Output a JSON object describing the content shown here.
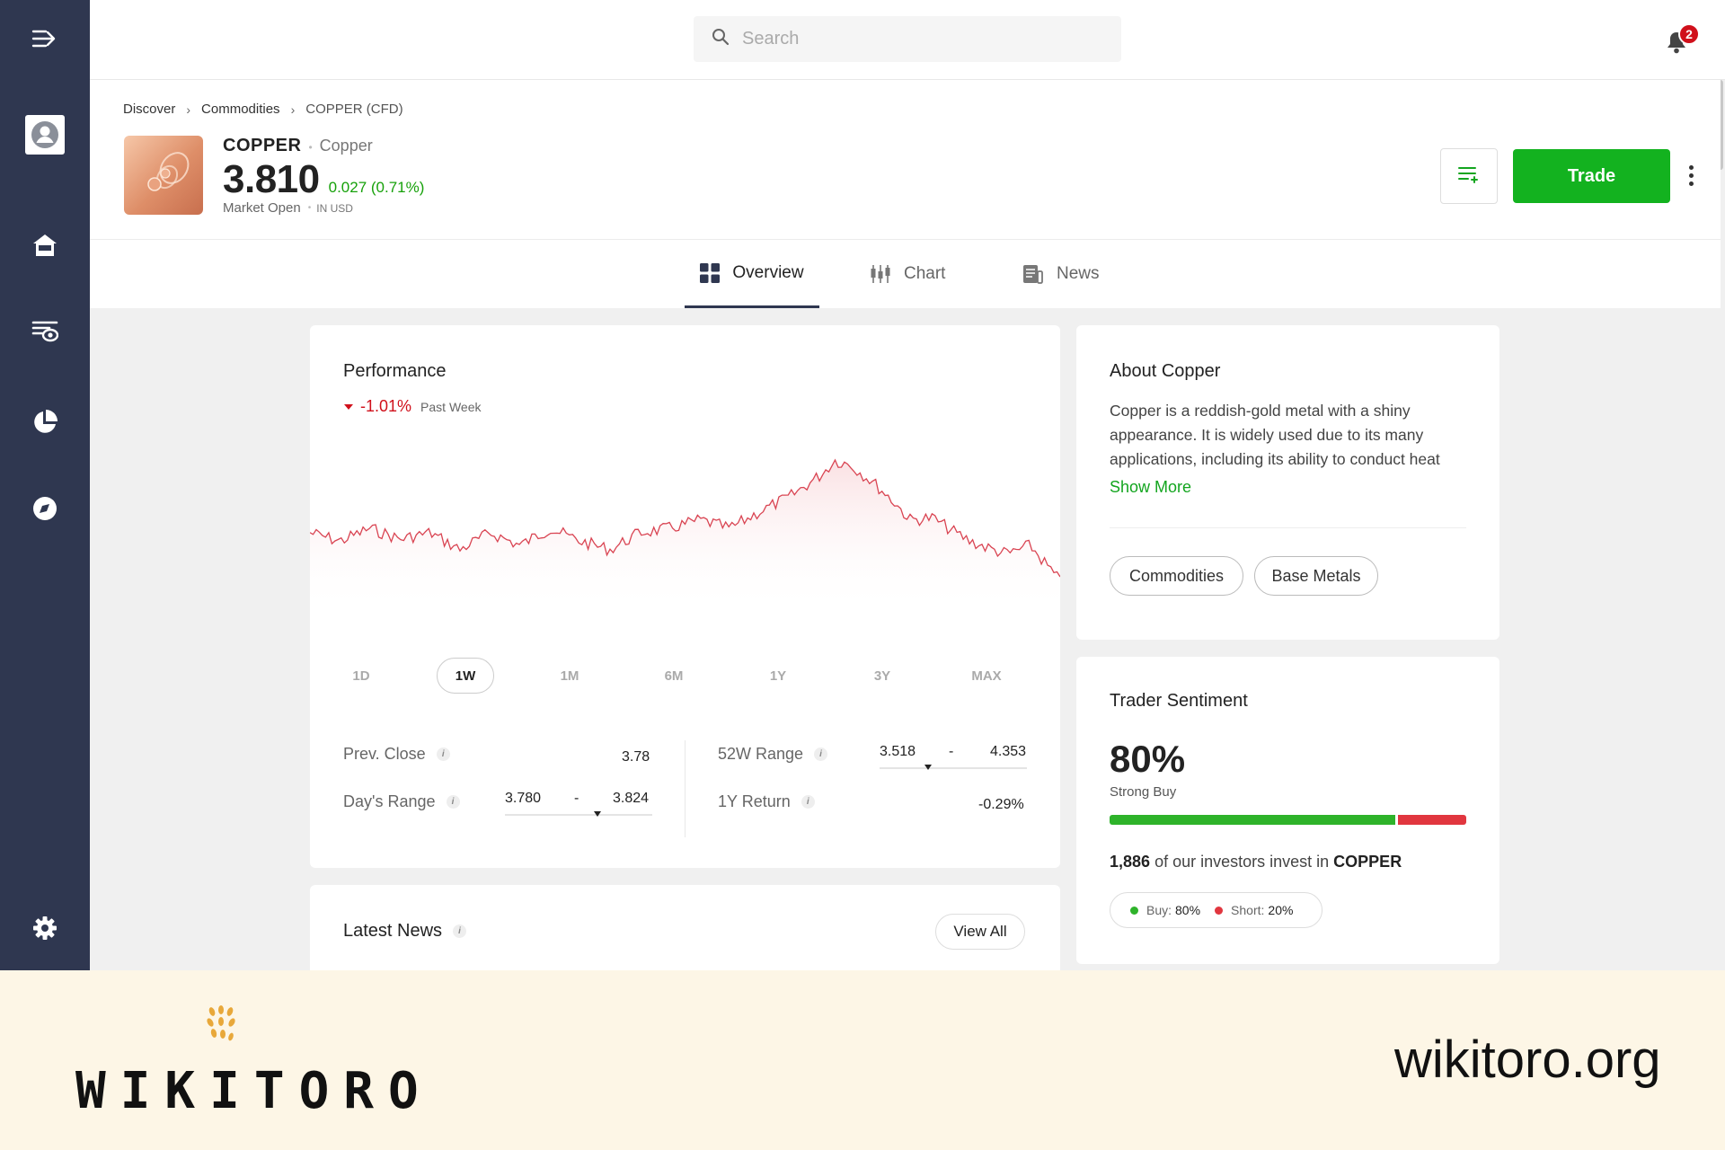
{
  "search": {
    "placeholder": "Search"
  },
  "notifications": {
    "count": "2"
  },
  "breadcrumb": {
    "items": [
      "Discover",
      "Commodities"
    ],
    "current": "COPPER (CFD)"
  },
  "asset": {
    "symbol": "COPPER",
    "name": "Copper",
    "price": "3.810",
    "change": "0.027 (0.71%)",
    "market_status": "Market Open",
    "currency": "IN USD"
  },
  "actions": {
    "trade_label": "Trade"
  },
  "tabs": [
    {
      "label": "Overview",
      "active": true
    },
    {
      "label": "Chart",
      "active": false
    },
    {
      "label": "News",
      "active": false
    }
  ],
  "performance": {
    "title": "Performance",
    "change": "-1.01%",
    "period": "Past Week",
    "ranges": [
      "1D",
      "1W",
      "1M",
      "6M",
      "1Y",
      "3Y",
      "MAX"
    ],
    "active_range": "1W",
    "stats": {
      "prev_close_label": "Prev. Close",
      "prev_close": "3.78",
      "days_range_label": "Day's Range",
      "days_low": "3.780",
      "days_high": "3.824",
      "days_position": 0.63,
      "range_52w_label": "52W Range",
      "low_52w": "3.518",
      "high_52w": "4.353",
      "position_52w": 0.33,
      "return_1y_label": "1Y Return",
      "return_1y": "-0.29%",
      "dash": "-"
    },
    "line_color": "#d94452"
  },
  "about": {
    "title": "About Copper",
    "text": "Copper is a reddish-gold metal with a shiny appearance. It is widely used due to its many applications, including its ability to conduct heat",
    "show_more": "Show More",
    "tags": [
      "Commodities",
      "Base Metals"
    ]
  },
  "sentiment": {
    "title": "Trader Sentiment",
    "percent": "80%",
    "label": "Strong Buy",
    "buy_fraction": 0.8,
    "investors_count": "1,886",
    "investors_text": "of our investors invest in",
    "investors_asset": "COPPER",
    "buy_label": "Buy:",
    "buy_value": "80%",
    "short_label": "Short:",
    "short_value": "20%",
    "buy_color": "#2eb32a",
    "short_color": "#e1363f"
  },
  "news": {
    "title": "Latest News",
    "view_all": "View All"
  },
  "watermark": {
    "brand": "WIKITORO",
    "url": "wikitoro.org"
  },
  "colors": {
    "accent_green": "#13b21f",
    "sidebar": "#2f3750",
    "negative": "#d0101b"
  }
}
